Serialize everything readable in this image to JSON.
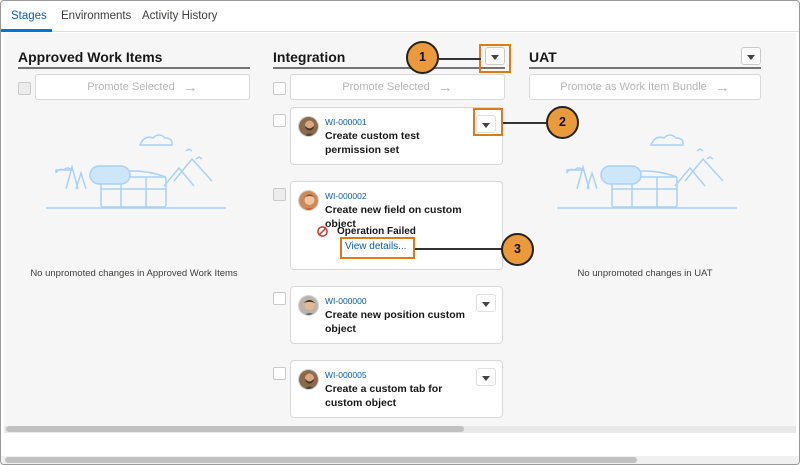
{
  "tabs": [
    {
      "label": "Stages",
      "active": true
    },
    {
      "label": "Environments",
      "active": false
    },
    {
      "label": "Activity History",
      "active": false
    }
  ],
  "columns": {
    "approved": {
      "title": "Approved Work Items",
      "promote_label": "Promote Selected",
      "empty_message": "No unpromoted changes in Approved Work Items"
    },
    "integration": {
      "title": "Integration",
      "promote_label": "Promote Selected",
      "cards": [
        {
          "id": "WI-000001",
          "title": "Create custom test permission set"
        },
        {
          "id": "WI-000002",
          "title": "Create new field on custom object",
          "status": "Operation Failed",
          "link": "View details..."
        },
        {
          "id": "WI-000000",
          "title": "Create new position custom object"
        },
        {
          "id": "WI-000005",
          "title": "Create a custom tab for custom object"
        }
      ]
    },
    "uat": {
      "title": "UAT",
      "promote_label": "Promote as Work Item Bundle",
      "empty_message": "No unpromoted changes in UAT"
    }
  },
  "callouts": [
    "1",
    "2",
    "3"
  ],
  "colors": {
    "accent": "#0176d3",
    "link": "#0b5cab",
    "highlight": "#e07a14",
    "callout_fill": "#eb9a3a",
    "error": "#c23934"
  }
}
